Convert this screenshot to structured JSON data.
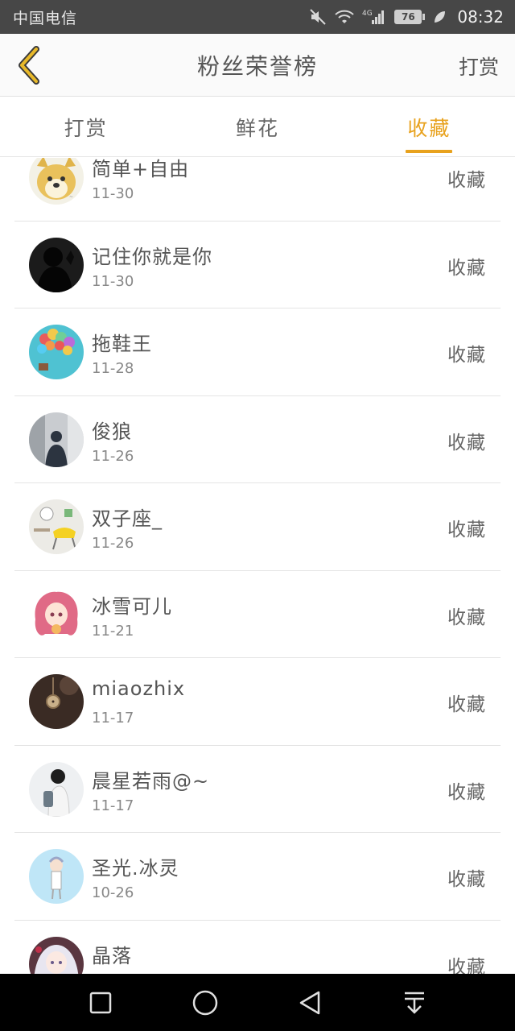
{
  "status_bar": {
    "carrier": "中国电信",
    "network": "4G",
    "battery": "76",
    "time": "08:32"
  },
  "header": {
    "title": "粉丝荣誉榜",
    "action_label": "打赏",
    "back_icon": "chevron-left-icon",
    "accent_color": "#e8a21e"
  },
  "tabs": [
    {
      "label": "打赏",
      "active": false
    },
    {
      "label": "鲜花",
      "active": false
    },
    {
      "label": "收藏",
      "active": true
    }
  ],
  "rows": [
    {
      "name": "简单+自由",
      "date": "11-30",
      "action": "收藏",
      "avatar": "shiba-dog-avatar"
    },
    {
      "name": "记住你就是你",
      "date": "11-30",
      "action": "收藏",
      "avatar": "dark-silhouette-avatar"
    },
    {
      "name": "拖鞋王",
      "date": "11-28",
      "action": "收藏",
      "avatar": "balloons-avatar"
    },
    {
      "name": "俊狼",
      "date": "11-26",
      "action": "收藏",
      "avatar": "window-figure-avatar"
    },
    {
      "name": "双子座_",
      "date": "11-26",
      "action": "收藏",
      "avatar": "room-chair-avatar"
    },
    {
      "name": "冰雪可儿",
      "date": "11-21",
      "action": "收藏",
      "avatar": "anime-girl-pink-avatar"
    },
    {
      "name": "miaozhix",
      "date": "11-17",
      "action": "收藏",
      "avatar": "pocket-watch-avatar"
    },
    {
      "name": "晨星若雨@~",
      "date": "11-17",
      "action": "收藏",
      "avatar": "girl-backpack-avatar"
    },
    {
      "name": "圣光.冰灵",
      "date": "10-26",
      "action": "收藏",
      "avatar": "anime-light-blue-avatar"
    },
    {
      "name": "晶落",
      "date": "",
      "action": "收藏",
      "avatar": "anime-white-hair-avatar"
    }
  ],
  "nav_bar": {
    "buttons": [
      "recent-apps-icon",
      "home-icon",
      "back-icon",
      "notification-pull-icon"
    ]
  }
}
